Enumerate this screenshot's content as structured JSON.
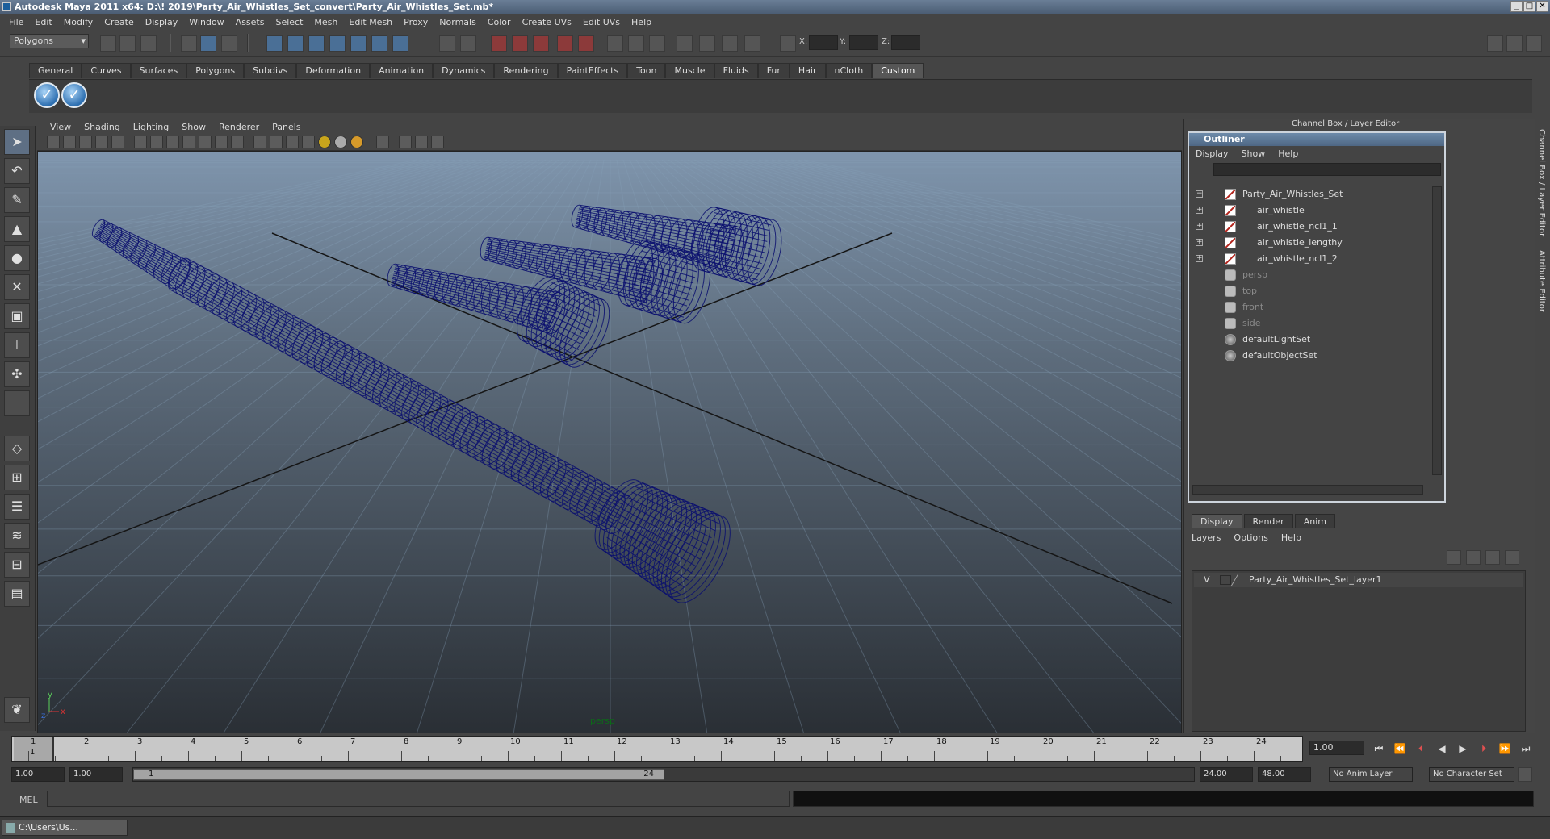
{
  "window": {
    "title": "Autodesk Maya 2011 x64: D:\\! 2019\\Party_Air_Whistles_Set_convert\\Party_Air_Whistles_Set.mb*",
    "btn_min": "_",
    "btn_max": "□",
    "btn_close": "✕"
  },
  "menu": [
    "File",
    "Edit",
    "Modify",
    "Create",
    "Display",
    "Window",
    "Assets",
    "Select",
    "Mesh",
    "Edit Mesh",
    "Proxy",
    "Normals",
    "Color",
    "Create UVs",
    "Edit UVs",
    "Help"
  ],
  "status": {
    "mode": "Polygons",
    "x_label": "X:",
    "y_label": "Y:",
    "z_label": "Z:"
  },
  "shelf": {
    "tabs": [
      "General",
      "Curves",
      "Surfaces",
      "Polygons",
      "Subdivs",
      "Deformation",
      "Animation",
      "Dynamics",
      "Rendering",
      "PaintEffects",
      "Toon",
      "Muscle",
      "Fluids",
      "Fur",
      "Hair",
      "nCloth",
      "Custom"
    ],
    "active_tab": "Custom",
    "check_glyph": "✓"
  },
  "viewport": {
    "menu": [
      "View",
      "Shading",
      "Lighting",
      "Show",
      "Renderer",
      "Panels"
    ],
    "camera_label": "persp",
    "axis_y": "y",
    "axis_x": "x",
    "axis_z": "z",
    "wire_color": "#0a0f6e"
  },
  "right_panel": {
    "header": "Channel Box / Layer Editor",
    "side_tab_1": "Channel Box / Layer Editor",
    "side_tab_2": "Attribute Editor"
  },
  "outliner": {
    "title": "Outliner",
    "menu": [
      "Display",
      "Show",
      "Help"
    ],
    "items": [
      {
        "label": "Party_Air_Whistles_Set",
        "expander": "−"
      },
      {
        "label": "air_whistle",
        "expander": "+"
      },
      {
        "label": "air_whistle_ncl1_1",
        "expander": "+"
      },
      {
        "label": "air_whistle_lengthy",
        "expander": "+"
      },
      {
        "label": "air_whistle_ncl1_2",
        "expander": "+"
      },
      {
        "label": "persp"
      },
      {
        "label": "top"
      },
      {
        "label": "front"
      },
      {
        "label": "side"
      },
      {
        "label": "defaultLightSet"
      },
      {
        "label": "defaultObjectSet"
      }
    ]
  },
  "layer_editor": {
    "tabs": [
      "Display",
      "Render",
      "Anim"
    ],
    "menu": [
      "Layers",
      "Options",
      "Help"
    ],
    "layer_visible": "V",
    "layer_name": "Party_Air_Whistles_Set_layer1"
  },
  "timeline": {
    "ticks": [
      "1",
      "2",
      "3",
      "4",
      "5",
      "6",
      "7",
      "8",
      "9",
      "10",
      "11",
      "12",
      "13",
      "14",
      "15",
      "16",
      "17",
      "18",
      "19",
      "20",
      "21",
      "22",
      "23",
      "24"
    ],
    "playhead_label": "1",
    "current_frame": "1.00"
  },
  "range": {
    "start": "1.00",
    "inner_start": "1.00",
    "handle_left": "1",
    "handle_right": "24",
    "inner_end": "24.00",
    "end": "48.00",
    "anim_layer": "No Anim Layer",
    "char_set": "No Character Set"
  },
  "command": {
    "label": "MEL"
  },
  "taskbar": {
    "item": "C:\\Users\\Us..."
  }
}
